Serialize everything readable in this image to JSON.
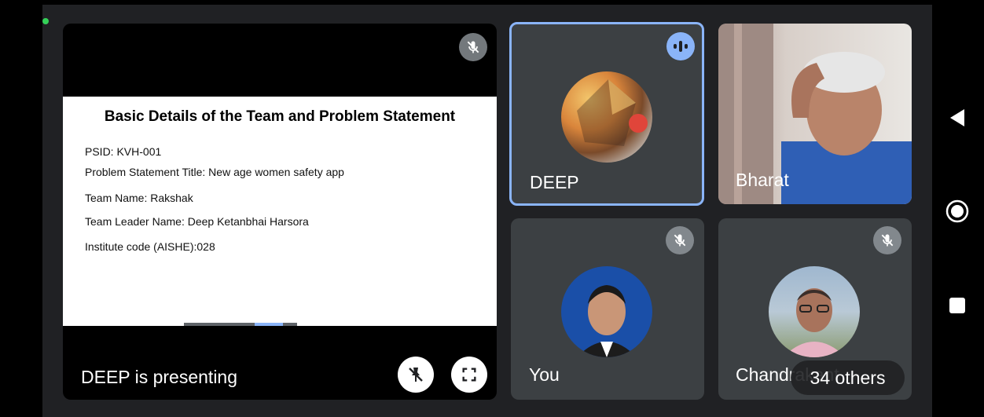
{
  "presentation": {
    "presenting_label": "DEEP is presenting",
    "slide": {
      "title": "Basic Details of the Team and Problem Statement",
      "lines": [
        "PSID: KVH-001",
        "Problem Statement Title: New age women safety app",
        "Team Name: Rakshak",
        "Team Leader Name: Deep Ketanbhai Harsora",
        "Institute code (AISHE):028"
      ]
    }
  },
  "participants": [
    {
      "name": "DEEP",
      "status": "speaking"
    },
    {
      "name": "Bharat",
      "status": "video"
    },
    {
      "name": "You",
      "status": "muted"
    },
    {
      "name": "Chandrakant",
      "status": "muted"
    }
  ],
  "others_label": "34 others",
  "colors": {
    "background": "#202124",
    "tile": "#3c4043",
    "active_speaker_border": "#8ab4f8",
    "speaking_indicator": "#8ab4f8",
    "status_dot": "#34d058"
  }
}
